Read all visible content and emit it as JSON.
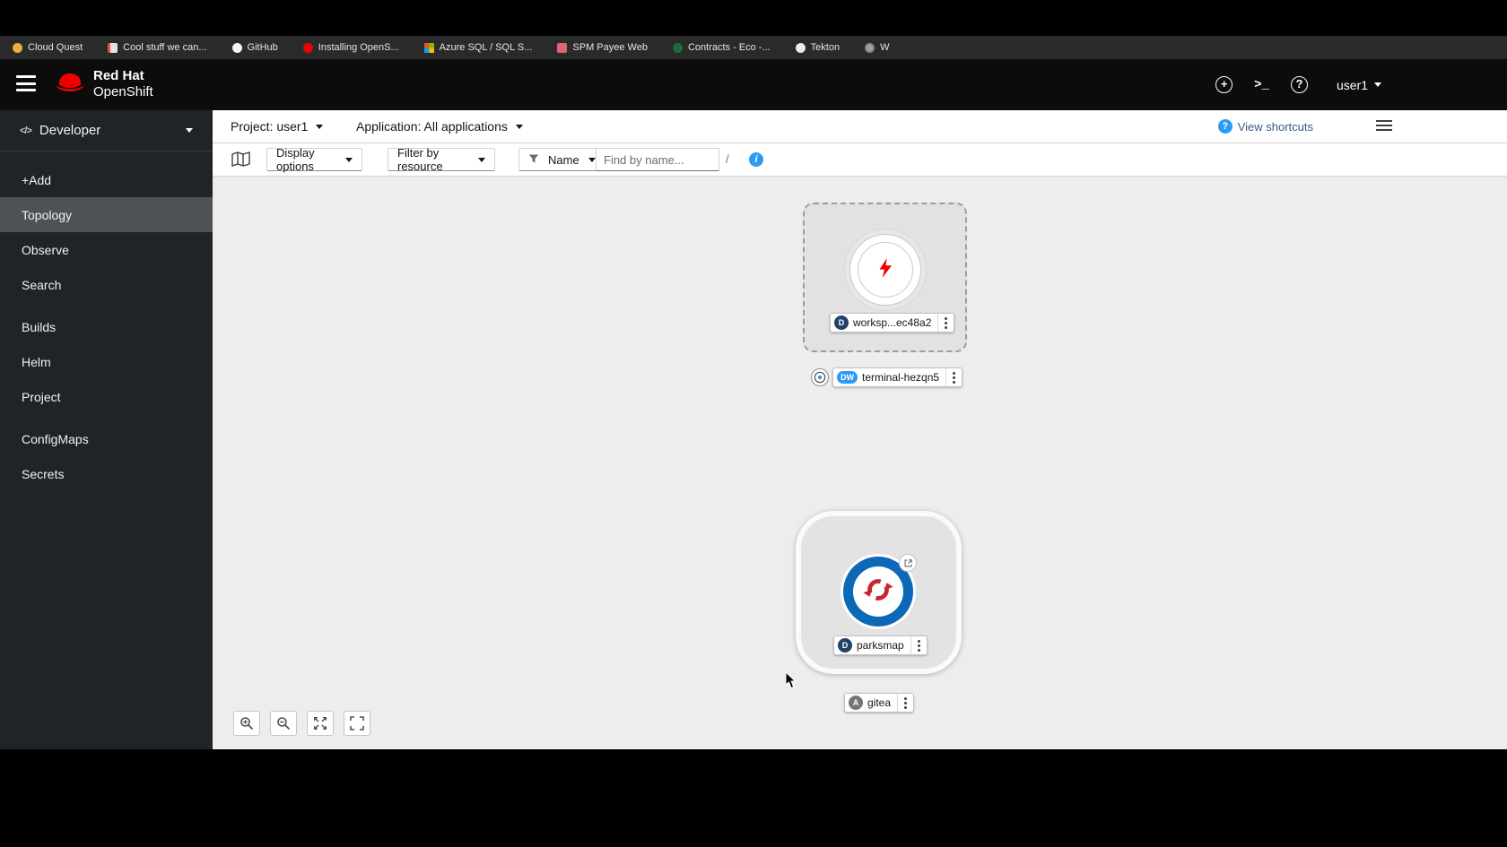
{
  "colors": {
    "brand_red": "#ee0000",
    "accent_blue": "#2b9af3",
    "canvas_bg": "#ededed",
    "masthead_bg": "#0c0c0c",
    "sidebar_bg": "#212427",
    "sidebar_selected_bg": "#4f5255",
    "badge_deployment": "#204368",
    "badge_devworkspace": "#2b9af3",
    "badge_application": "#72767b",
    "parksmap_icon_blue": "#0d68b8"
  },
  "bookmarks": {
    "items": [
      {
        "label": "Cloud Quest",
        "icon": "cloud-quest-favicon"
      },
      {
        "label": "Cool stuff we can...",
        "icon": "document-favicon"
      },
      {
        "label": "GitHub",
        "icon": "github-favicon"
      },
      {
        "label": "Installing OpenS...",
        "icon": "openshift-favicon"
      },
      {
        "label": "Azure SQL / SQL S...",
        "icon": "microsoft-grid-favicon"
      },
      {
        "label": "SPM Payee Web",
        "icon": "web-app-favicon"
      },
      {
        "label": "Contracts - Eco -...",
        "icon": "globe-favicon"
      },
      {
        "label": "Tekton",
        "icon": "tekton-favicon"
      },
      {
        "label": "W",
        "icon": "globe-favicon"
      }
    ]
  },
  "masthead": {
    "brand_line1": "Red Hat",
    "brand_line2": "OpenShift",
    "username": "user1"
  },
  "sidebar": {
    "perspective": "Developer",
    "groups": [
      {
        "items": [
          {
            "label": "+Add",
            "selected": false
          },
          {
            "label": "Topology",
            "selected": true
          },
          {
            "label": "Observe",
            "selected": false
          },
          {
            "label": "Search",
            "selected": false
          }
        ]
      },
      {
        "items": [
          {
            "label": "Builds",
            "selected": false
          },
          {
            "label": "Helm",
            "selected": false
          },
          {
            "label": "Project",
            "selected": false
          }
        ]
      },
      {
        "items": [
          {
            "label": "ConfigMaps",
            "selected": false
          },
          {
            "label": "Secrets",
            "selected": false
          }
        ]
      }
    ]
  },
  "context_bar": {
    "project": "Project: user1",
    "application": "Application: All applications",
    "view_shortcuts": "View shortcuts"
  },
  "toolbar": {
    "display_options": "Display options",
    "filter_by_resource": "Filter by resource",
    "name_filter": "Name",
    "find_placeholder": "Find by name...",
    "find_value": "",
    "shortcut_hint": "/"
  },
  "topology": {
    "nodes": {
      "workspace": {
        "label": "worksp...ec48a2",
        "badge": "D"
      },
      "terminal": {
        "label": "terminal-hezqn5",
        "badge": "DW"
      },
      "parksmap": {
        "label": "parksmap",
        "badge": "D"
      },
      "gitea": {
        "label": "gitea",
        "badge": "A"
      }
    }
  }
}
